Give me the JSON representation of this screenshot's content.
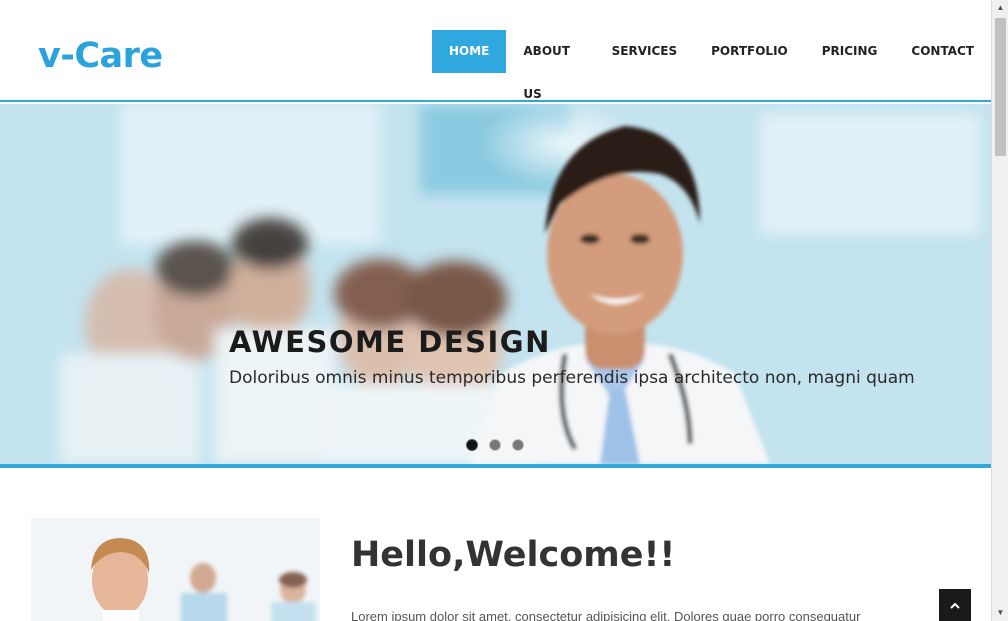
{
  "brand": {
    "logo": "v-Care",
    "accent_color": "#2ea8df"
  },
  "nav": {
    "items": [
      {
        "label": "HOME",
        "active": true
      },
      {
        "label": "ABOUT US",
        "active": false
      },
      {
        "label": "SERVICES",
        "active": false
      },
      {
        "label": "PORTFOLIO",
        "active": false
      },
      {
        "label": "PRICING",
        "active": false
      },
      {
        "label": "CONTACT",
        "active": false
      }
    ]
  },
  "hero": {
    "title": "AWESOME DESIGN",
    "subtitle": "Doloribus omnis minus temporibus perferendis ipsa architecto non, magni quam",
    "slides_count": 3,
    "active_slide": 1
  },
  "welcome": {
    "heading": "Hello,Welcome!!",
    "text": "Lorem ipsum dolor sit amet, consectetur adipisicing elit. Dolores quae porro consequatur"
  },
  "icons": {
    "back_to_top": "chevron-up-icon",
    "scroll_up": "triangle-up-icon",
    "scroll_down": "triangle-down-icon"
  }
}
